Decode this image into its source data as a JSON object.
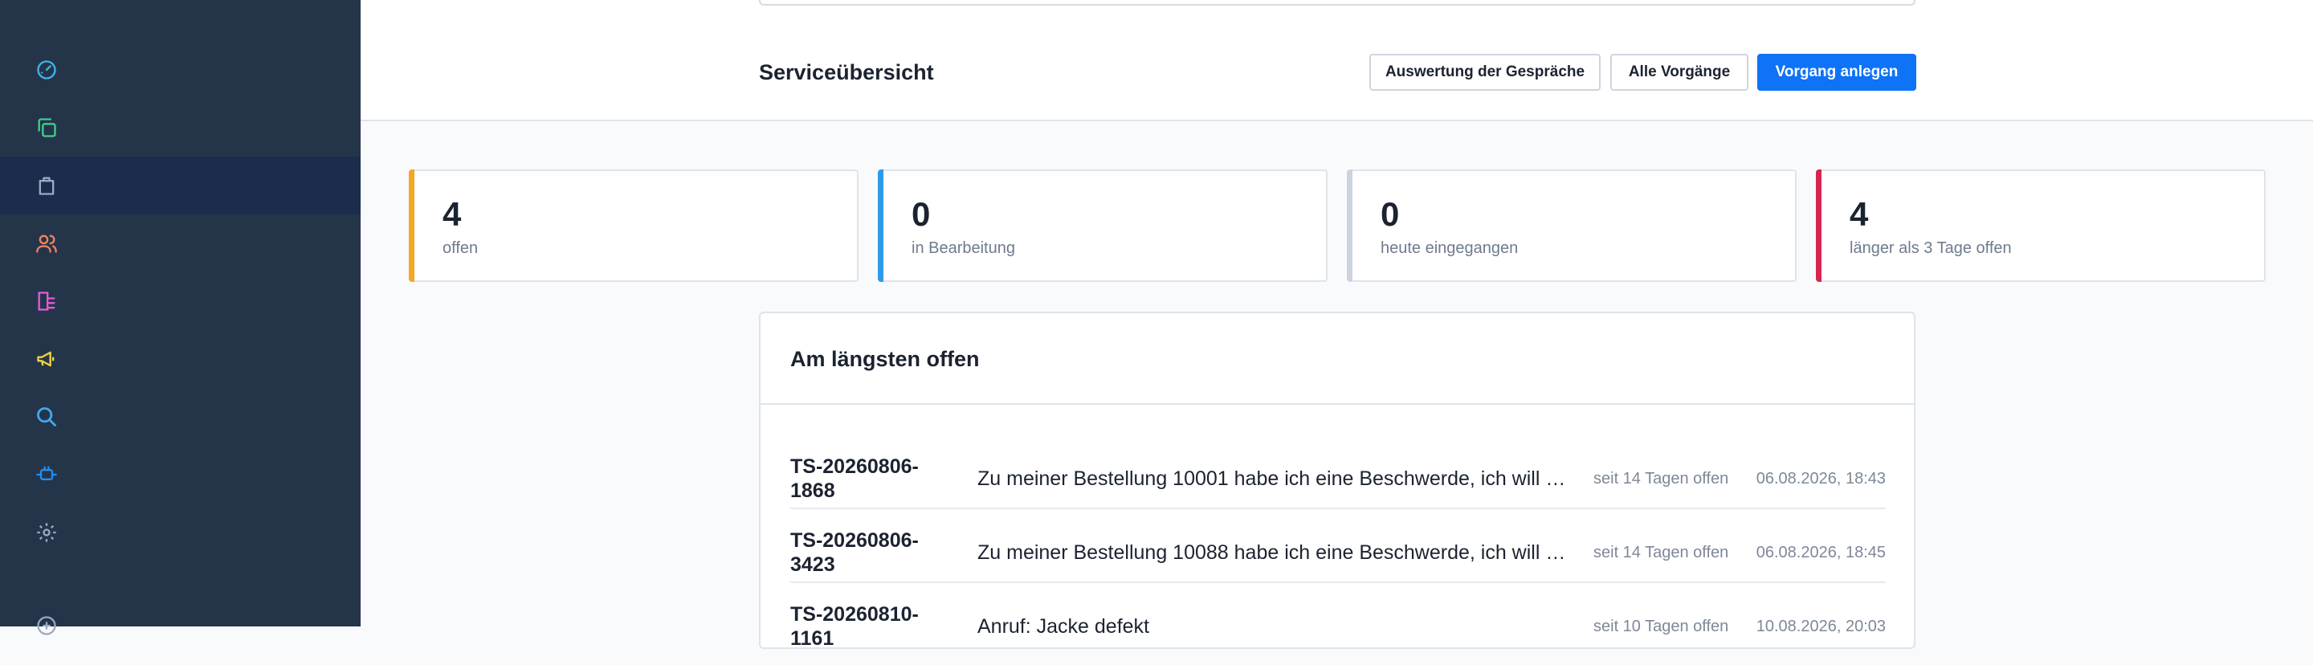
{
  "sidebar": {
    "items": [
      {
        "name": "dashboard",
        "icon": "gauge-icon",
        "color": "#3fb5e8"
      },
      {
        "name": "copies",
        "icon": "copy-icon",
        "color": "#3fcf8e"
      },
      {
        "name": "shopping",
        "icon": "shopping-bag-icon",
        "color": "#9aa9c4"
      },
      {
        "name": "customers",
        "icon": "users-icon",
        "color": "#f0845e"
      },
      {
        "name": "lists",
        "icon": "list-icon",
        "color": "#e45ad8"
      },
      {
        "name": "marketing",
        "icon": "megaphone-icon",
        "color": "#f2d43c"
      },
      {
        "name": "search",
        "icon": "search-icon",
        "color": "#3fa9f5"
      },
      {
        "name": "plugins",
        "icon": "plug-icon",
        "color": "#1f8ef1"
      },
      {
        "name": "settings",
        "icon": "gear-icon",
        "color": "#9aa9c4"
      }
    ]
  },
  "header": {
    "title": "Serviceübersicht",
    "buttons": {
      "evaluation": "Auswertung der Gespräche",
      "all_cases": "Alle Vorgänge",
      "create_case": "Vorgang anlegen"
    }
  },
  "stats": [
    {
      "value": "4",
      "label": "offen",
      "color": "#f5a623"
    },
    {
      "value": "0",
      "label": "in Bearbeitung",
      "color": "#2f9be8"
    },
    {
      "value": "0",
      "label": "heute eingegangen",
      "color": "#cbd3de"
    },
    {
      "value": "4",
      "label": "länger als 3 Tage offen",
      "color": "#d6264d"
    }
  ],
  "longest_open": {
    "title": "Am längsten offen",
    "rows": [
      {
        "id": "TS-20260806-1868",
        "subject": "Zu meiner Bestellung 10001 habe ich eine Beschwerde, ich will …",
        "age": "seit 14 Tagen offen",
        "date": "06.08.2026, 18:43"
      },
      {
        "id": "TS-20260806-3423",
        "subject": "Zu meiner Bestellung 10088 habe ich eine Beschwerde, ich will …",
        "age": "seit 14 Tagen offen",
        "date": "06.08.2026, 18:45"
      },
      {
        "id": "TS-20260810-1161",
        "subject": "Anruf: Jacke defekt",
        "age": "seit 10 Tagen offen",
        "date": "10.08.2026, 20:03"
      }
    ]
  }
}
